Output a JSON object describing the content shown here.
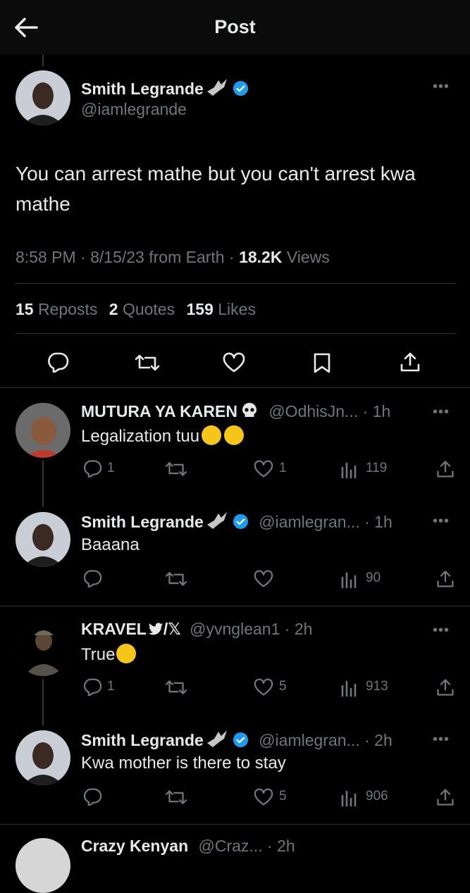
{
  "header": {
    "title": "Post"
  },
  "post": {
    "author_name": "Smith Legrande",
    "author_handle": "@iamlegrande",
    "text": "You can arrest mathe but you can't arrest kwa mathe",
    "time": "8:58 PM",
    "date": "8/15/23 from Earth",
    "views_count": "18.2K",
    "views_label": "Views",
    "reposts_count": "15",
    "reposts_label": "Reposts",
    "quotes_count": "2",
    "quotes_label": "Quotes",
    "likes_count": "159",
    "likes_label": "Likes"
  },
  "replies": [
    {
      "name": "MUTURA YA KAREN",
      "handle": "@OdhisJn...",
      "time": "1h",
      "text": "Legalization tuu",
      "replies": "1",
      "likes": "1",
      "views": "119"
    },
    {
      "name": "Smith Legrande",
      "handle": "@iamlegran...",
      "time": "1h",
      "text": "Baaana",
      "replies": "",
      "likes": "",
      "views": "90"
    },
    {
      "name": "KRAVEL",
      "name_suffix": "/𝕏",
      "handle": "@yvnglean1",
      "time": "2h",
      "text": "True",
      "replies": "1",
      "likes": "5",
      "views": "913"
    },
    {
      "name": "Smith Legrande",
      "handle": "@iamlegran...",
      "time": "2h",
      "text": "Kwa mother is there to stay",
      "replies": "",
      "likes": "5",
      "views": "906"
    }
  ],
  "partial": {
    "name": "Crazy Kenyan",
    "handle": "@Craz...",
    "time": "2h"
  },
  "colors": {
    "background": "#000000",
    "text": "#e7e9ea",
    "muted": "#71767b",
    "verified": "#1d9bf0",
    "divider": "#2f3336"
  }
}
